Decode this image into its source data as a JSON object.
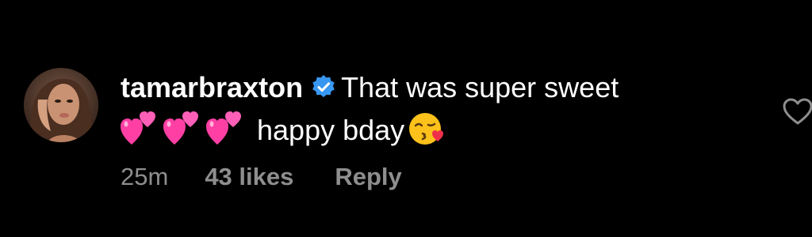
{
  "comment": {
    "username": "tamarbraxton",
    "verified": true,
    "text_line1": "That was super sweet",
    "text_line2": "happy bday",
    "emoji_hearts": [
      "💞",
      "💞",
      "💞"
    ],
    "emoji_end": "😘",
    "time": "25m",
    "likes": "43 likes",
    "reply_label": "Reply"
  },
  "colors": {
    "background": "#000000",
    "text": "#ffffff",
    "meta": "#8e8e8e",
    "verified_badge": "#3897f0",
    "heart_pink": "#ff3fa4"
  },
  "icons": {
    "verified": "verified-badge-icon",
    "like": "heart-outline-icon"
  }
}
